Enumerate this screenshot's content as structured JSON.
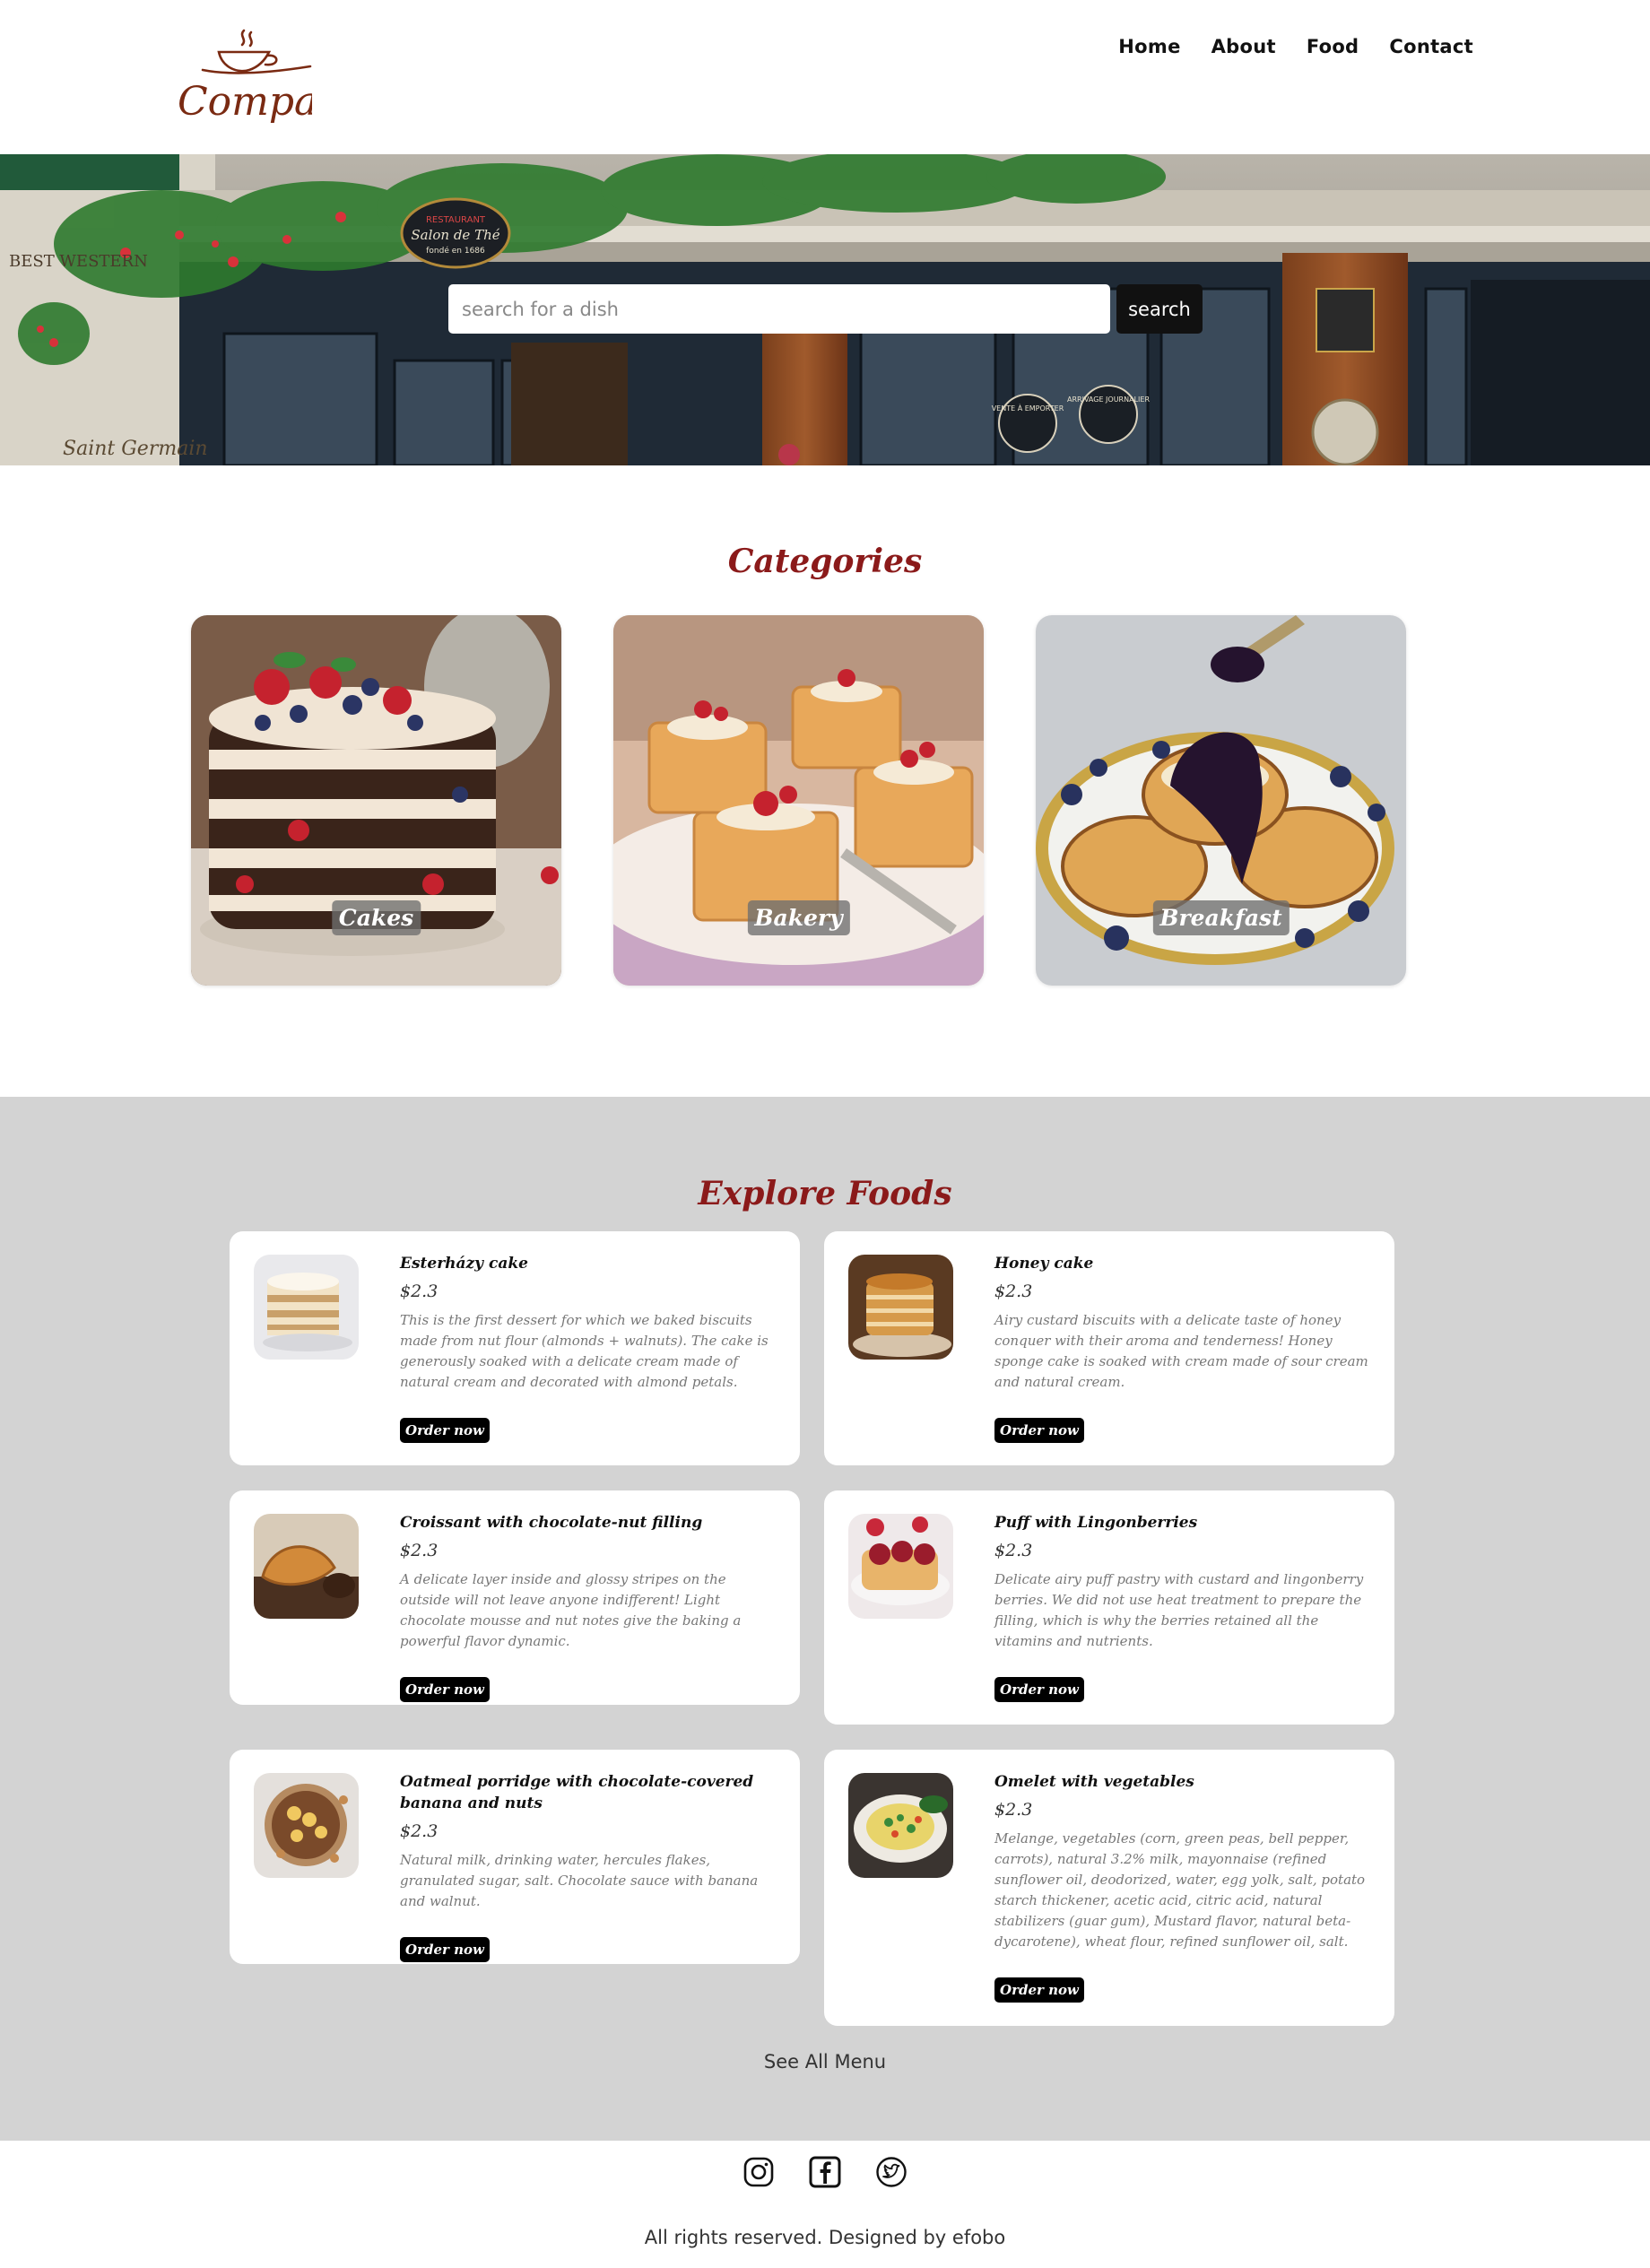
{
  "brand": {
    "logo_text": "Company",
    "logo_color": "#7a2a12"
  },
  "nav": {
    "items": [
      "Home",
      "About",
      "Food",
      "Contact"
    ]
  },
  "hero": {
    "search_placeholder": "search for a dish",
    "search_button": "search",
    "sign_texts": [
      "RESTAURANT",
      "Salon de Thé",
      "fondé en 1686",
      "VENTE À EMPORTER",
      "ARRIVAGE JOURNALIER",
      "BEST WESTERN",
      "Saint Germain"
    ]
  },
  "categories": {
    "title": "Categories",
    "items": [
      {
        "label": "Cakes",
        "icon": "layer-cake-image"
      },
      {
        "label": "Bakery",
        "icon": "puff-pastry-image"
      },
      {
        "label": "Breakfast",
        "icon": "pancakes-blueberry-image"
      }
    ]
  },
  "explore": {
    "title": "Explore Foods",
    "order_label": "Order now",
    "see_all": "See All Menu",
    "foods": [
      {
        "name": "Esterházy cake",
        "price": "$2.3",
        "desc": "This is the first dessert for which we baked biscuits made from nut flour (almonds + walnuts). The cake is generously soaked with a delicate cream made of natural cream and decorated with almond petals."
      },
      {
        "name": "Honey cake",
        "price": "$2.3",
        "desc": "Airy custard biscuits with a delicate taste of honey conquer with their aroma and tenderness! Honey sponge cake is soaked with cream made of sour cream and natural cream."
      },
      {
        "name": "Croissant with chocolate-nut filling",
        "price": "$2.3",
        "desc": "A delicate layer inside and glossy stripes on the outside will not leave anyone indifferent! Light chocolate mousse and nut notes give the baking a powerful flavor dynamic."
      },
      {
        "name": "Puff with Lingonberries",
        "price": "$2.3",
        "desc": "Delicate airy puff pastry with custard and lingonberry berries. We did not use heat treatment to prepare the filling, which is why the berries retained all the vitamins and nutrients."
      },
      {
        "name": "Oatmeal porridge with chocolate-covered banana and nuts",
        "price": "$2.3",
        "desc": "Natural milk, drinking water, hercules flakes, granulated sugar, salt. Chocolate sauce with banana and walnut."
      },
      {
        "name": "Omelet with vegetables",
        "price": "$2.3",
        "desc": "Melange, vegetables (corn, green peas, bell pepper, carrots), natural 3.2% milk, mayonnaise (refined sunflower oil, deodorized, water, egg yolk, salt, potato starch thickener, acetic acid, citric acid, natural stabilizers (guar gum), Mustard flavor, natural beta-dycarotene), wheat flour, refined sunflower oil, salt."
      }
    ]
  },
  "footer": {
    "icons": [
      "instagram-icon",
      "facebook-icon",
      "twitter-icon"
    ],
    "copyright": "All rights reserved. Designed by efobo"
  },
  "colors": {
    "accent": "#8b1a1a",
    "explore_bg": "#d3d3d3",
    "button": "#000000"
  }
}
